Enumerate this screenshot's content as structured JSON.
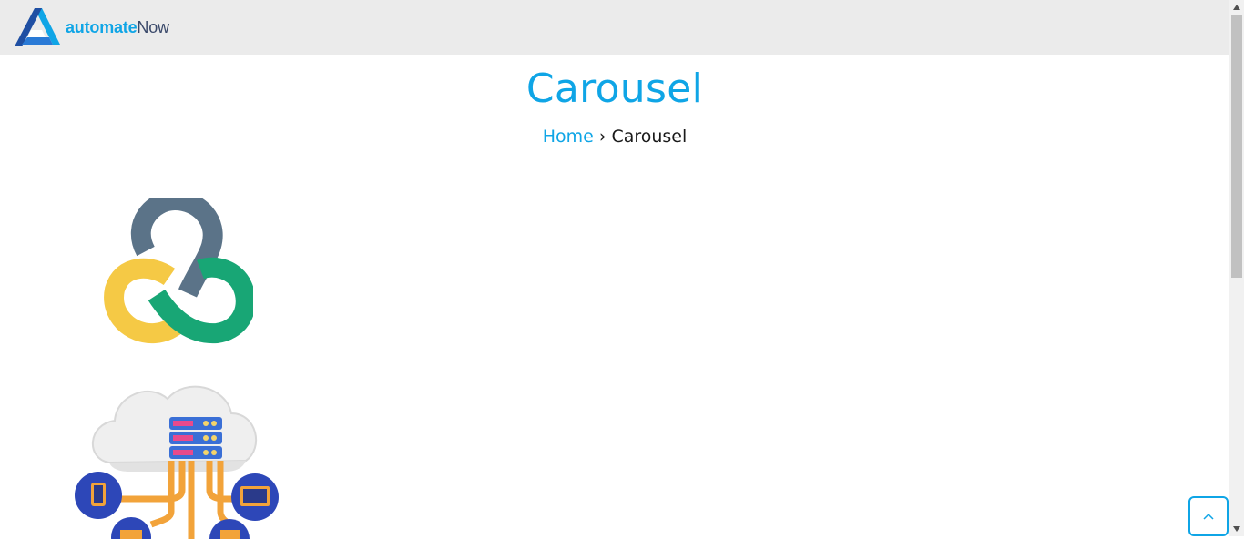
{
  "header": {
    "logo": {
      "text_part_1": "automate",
      "text_part_2": "Now",
      "icon": "automatenow-logo-icon"
    }
  },
  "main": {
    "title": "Carousel",
    "breadcrumb": {
      "home_label": "Home",
      "separator": "›",
      "current_label": "Carousel"
    },
    "carousel": {
      "slides": [
        {
          "icon": "tri-link-logo-icon"
        },
        {
          "icon": "cloud-server-network-icon"
        }
      ]
    }
  },
  "controls": {
    "back_to_top_icon": "chevron-up-icon"
  },
  "colors": {
    "accent": "#0fa5e6",
    "header_bg": "#ebebeb",
    "logo_dark": "#3b4a6b"
  }
}
